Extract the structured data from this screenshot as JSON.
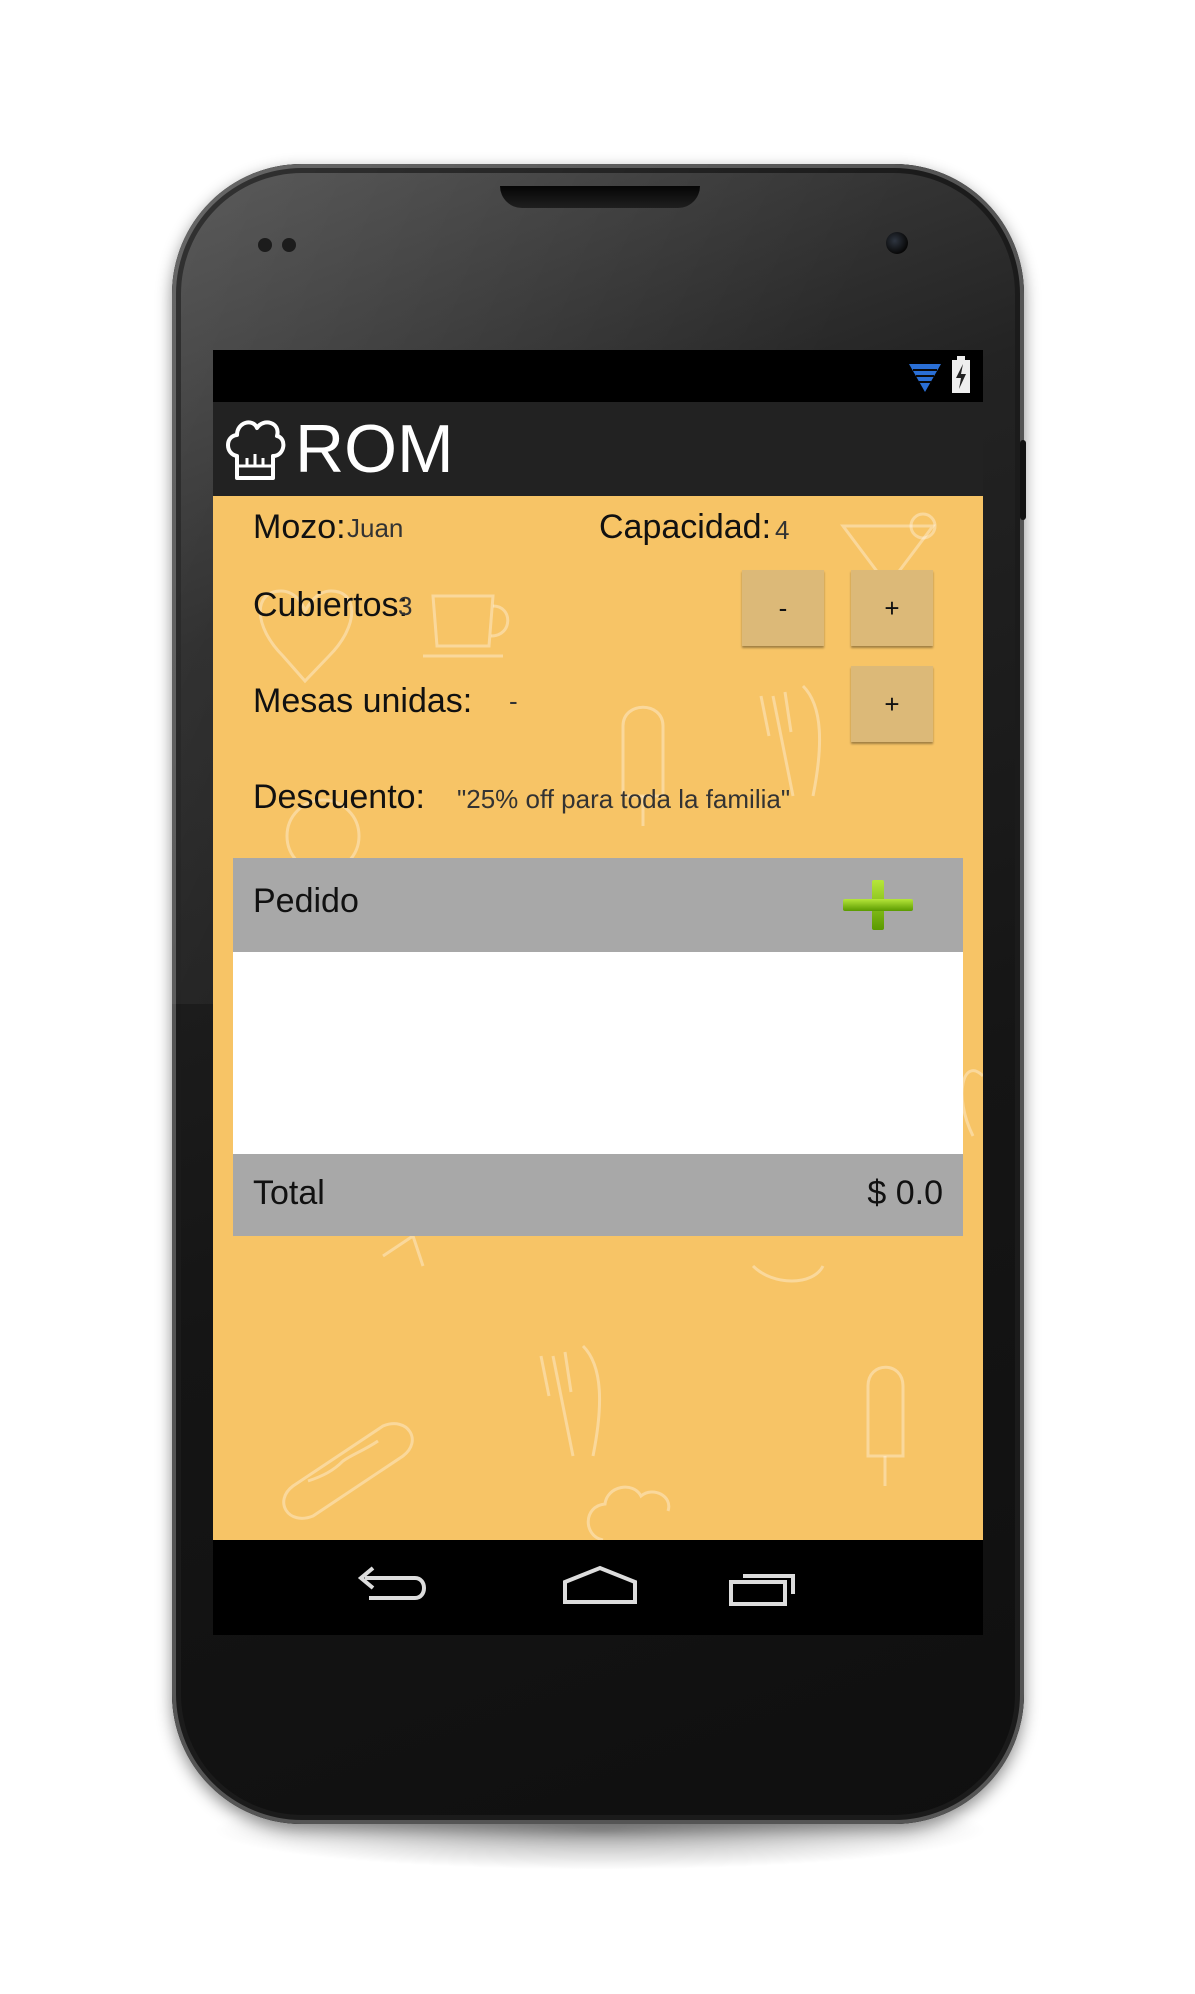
{
  "app": {
    "title": "ROM"
  },
  "status_bar": {
    "icons": [
      "wifi-icon",
      "battery-charging-icon"
    ]
  },
  "table_info": {
    "mozo_label": "Mozo:",
    "mozo_value": "Juan",
    "capacidad_label": "Capacidad:",
    "capacidad_value": "4",
    "cubiertos_label": "Cubiertos:",
    "cubiertos_value": "3",
    "minus_label": "-",
    "plus_label": "+",
    "mesas_label": "Mesas unidas:",
    "mesas_value": "-",
    "mesas_plus_label": "+",
    "descuento_label": "Descuento:",
    "descuento_value": "\"25% off para toda la familia\""
  },
  "order": {
    "header_label": "Pedido",
    "add_icon": "plus-icon",
    "items": [],
    "total_label": "Total",
    "total_value": "$ 0.0"
  },
  "nav_bar": {
    "buttons": [
      "back-icon",
      "home-icon",
      "recent-apps-icon"
    ]
  },
  "colors": {
    "background": "#f7c466",
    "action_bar": "#222222",
    "button": "#dcb978",
    "order_bar": "#a8a8a8",
    "accent_plus": "#7fc400"
  }
}
